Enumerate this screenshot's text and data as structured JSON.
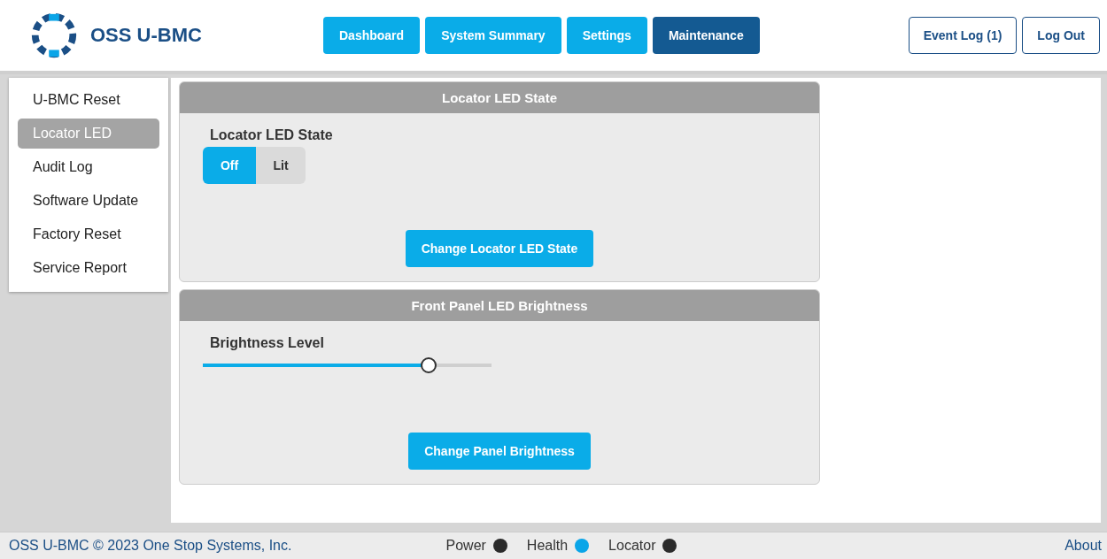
{
  "header": {
    "title": "OSS U-BMC",
    "nav": [
      {
        "label": "Dashboard",
        "selected": false
      },
      {
        "label": "System Summary",
        "selected": false
      },
      {
        "label": "Settings",
        "selected": false
      },
      {
        "label": "Maintenance",
        "selected": true
      }
    ],
    "actions": [
      "Event Log (1)",
      "Log Out"
    ]
  },
  "sidebar": {
    "items": [
      {
        "label": "U-BMC Reset",
        "selected": false
      },
      {
        "label": "Locator LED",
        "selected": true
      },
      {
        "label": "Audit Log",
        "selected": false
      },
      {
        "label": "Software Update",
        "selected": false
      },
      {
        "label": "Factory Reset",
        "selected": false
      },
      {
        "label": "Service Report",
        "selected": false
      }
    ]
  },
  "panels": [
    {
      "kind": "toggle",
      "title": "Locator LED State",
      "label": "Locator LED State",
      "options": [
        {
          "label": "Off",
          "selected": true
        },
        {
          "label": "Lit",
          "selected": false
        }
      ],
      "button": "Change Locator LED State"
    },
    {
      "kind": "slider",
      "title": "Front Panel LED Brightness",
      "label": "Brightness Level",
      "level": 0.8,
      "button": "Change Panel Brightness"
    }
  ],
  "status_bar": {
    "copyright": "OSS U-BMC © 2023 One Stop Systems, Inc.",
    "indicators": [
      {
        "label": "Power",
        "color": "#2b2b2b"
      },
      {
        "label": "Health",
        "color": "#0aa5e8"
      },
      {
        "label": "Locator",
        "color": "#2b2b2b"
      }
    ],
    "link": "About"
  }
}
